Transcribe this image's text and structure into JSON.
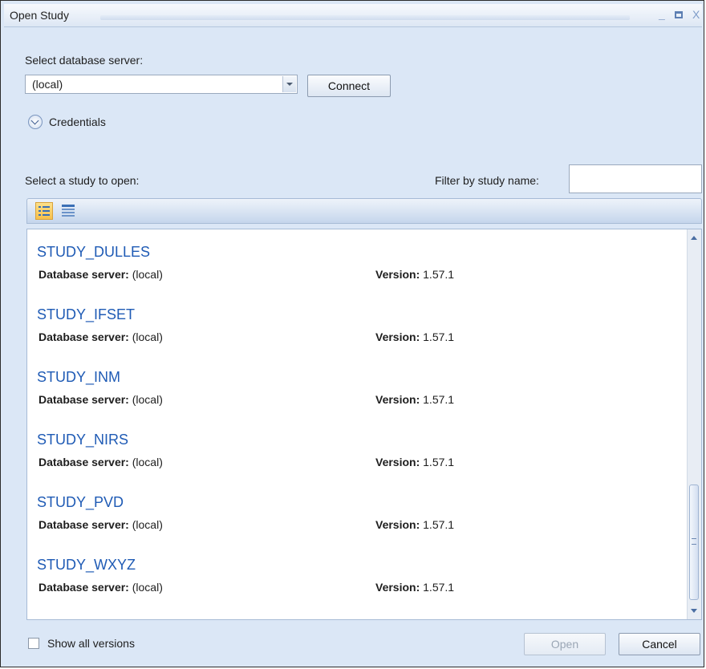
{
  "window": {
    "title": "Open Study"
  },
  "server": {
    "label": "Select database server:",
    "value": "(local)",
    "connect_label": "Connect",
    "credentials_label": "Credentials"
  },
  "studies": {
    "label": "Select a study to open:",
    "filter_label": "Filter by study name:",
    "filter_value": "",
    "items": [
      {
        "name": "STUDY_DULLES",
        "server_label": "Database server:",
        "server": "(local)",
        "version_label": "Version:",
        "version": "1.57.1"
      },
      {
        "name": "STUDY_IFSET",
        "server_label": "Database server:",
        "server": "(local)",
        "version_label": "Version:",
        "version": "1.57.1"
      },
      {
        "name": "STUDY_INM",
        "server_label": "Database server:",
        "server": "(local)",
        "version_label": "Version:",
        "version": "1.57.1"
      },
      {
        "name": "STUDY_NIRS",
        "server_label": "Database server:",
        "server": "(local)",
        "version_label": "Version:",
        "version": "1.57.1"
      },
      {
        "name": "STUDY_PVD",
        "server_label": "Database server:",
        "server": "(local)",
        "version_label": "Version:",
        "version": "1.57.1"
      },
      {
        "name": "STUDY_WXYZ",
        "server_label": "Database server:",
        "server": "(local)",
        "version_label": "Version:",
        "version": "1.57.1"
      }
    ]
  },
  "footer": {
    "show_all_label": "Show all versions",
    "open_label": "Open",
    "cancel_label": "Cancel"
  },
  "icons": {
    "minimize": "minimize-icon",
    "maximize": "maximize-icon",
    "close": "close-icon",
    "credentials": "chevron-down-icon",
    "view_details": "details-view-icon",
    "view_grid": "grid-view-icon"
  }
}
